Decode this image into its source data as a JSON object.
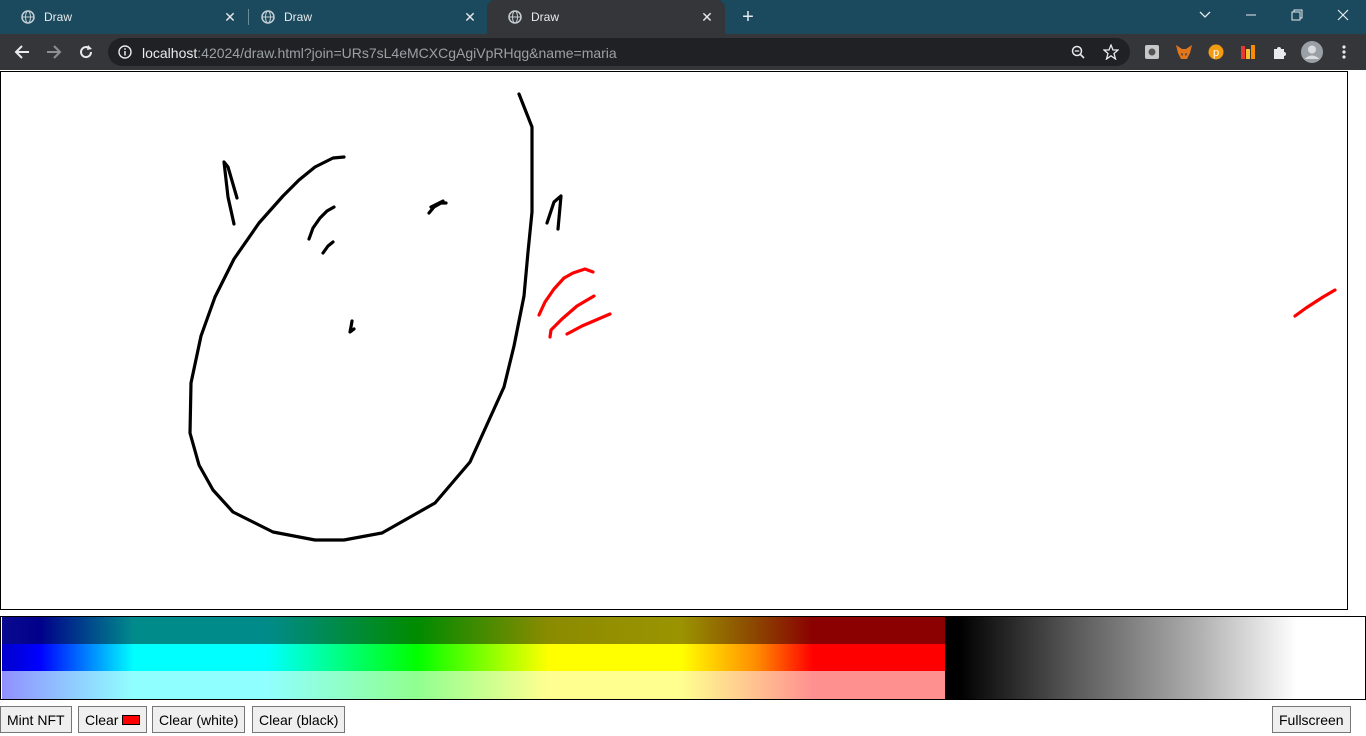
{
  "browser": {
    "tabs": [
      {
        "title": "Draw",
        "active": false
      },
      {
        "title": "Draw",
        "active": false
      },
      {
        "title": "Draw",
        "active": true
      }
    ],
    "address": {
      "host": "localhost",
      "rest": ":42024/draw.html?join=URs7sL4eMCXCgAgiVpRHqg&name=maria"
    }
  },
  "buttons": {
    "mint": "Mint NFT",
    "clear": "Clear",
    "clear_white": "Clear (white)",
    "clear_black": "Clear (black)",
    "fullscreen": "Fullscreen"
  },
  "colors": {
    "tabbar": "#1b4a5e",
    "toolbar": "#35363a",
    "ink_black": "#000000",
    "ink_red": "#ff0000",
    "clear_swatch": "#ff0000"
  }
}
